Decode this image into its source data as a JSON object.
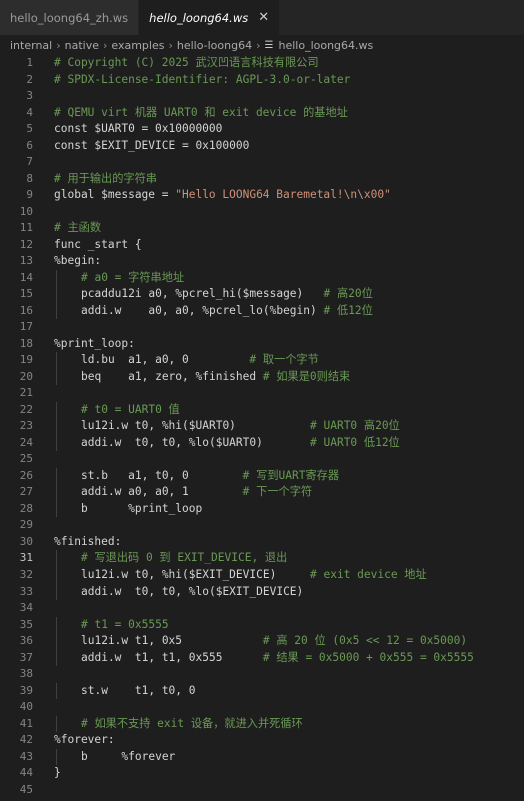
{
  "tabs": [
    {
      "label": "hello_loong64_zh.ws",
      "active": false
    },
    {
      "label": "hello_loong64.ws",
      "active": true
    }
  ],
  "close_glyph": "✕",
  "breadcrumb": [
    "internal",
    "native",
    "examples",
    "hello-loong64",
    "hello_loong64.ws"
  ],
  "breadcrumb_sep": "›",
  "current_line": 31,
  "colors": {
    "background": "#1e1e1e",
    "comment": "#6a9955",
    "string": "#ce9178",
    "text": "#d4d4d4",
    "line_number": "#858585"
  },
  "code_lines": [
    {
      "n": "1",
      "indent": 0,
      "text": "# Copyright (C) 2025 武汉凹语言科技有限公司",
      "kind": "comment"
    },
    {
      "n": "2",
      "indent": 0,
      "text": "# SPDX-License-Identifier: AGPL-3.0-or-later",
      "kind": "comment"
    },
    {
      "n": "3",
      "indent": 0,
      "text": "",
      "kind": "plain"
    },
    {
      "n": "4",
      "indent": 0,
      "text": "# QEMU virt 机器 UART0 和 exit device 的基地址",
      "kind": "comment"
    },
    {
      "n": "5",
      "indent": 0,
      "text": "const $UART0 = 0x10000000",
      "kind": "plain"
    },
    {
      "n": "6",
      "indent": 0,
      "text": "const $EXIT_DEVICE = 0x100000",
      "kind": "plain"
    },
    {
      "n": "7",
      "indent": 0,
      "text": "",
      "kind": "plain"
    },
    {
      "n": "8",
      "indent": 0,
      "text": "# 用于输出的字符串",
      "kind": "comment"
    },
    {
      "n": "9",
      "indent": 0,
      "text": "global $message = \"Hello LOONG64 Baremetal!\\n\\x00\"",
      "kind": "plain"
    },
    {
      "n": "10",
      "indent": 0,
      "text": "",
      "kind": "plain"
    },
    {
      "n": "11",
      "indent": 0,
      "text": "# 主函数",
      "kind": "comment"
    },
    {
      "n": "12",
      "indent": 0,
      "text": "func _start {",
      "kind": "plain"
    },
    {
      "n": "13",
      "indent": 0,
      "text": "%begin:",
      "kind": "plain"
    },
    {
      "n": "14",
      "indent": 1,
      "text": "# a0 = 字符串地址",
      "kind": "comment"
    },
    {
      "n": "15",
      "indent": 1,
      "text": "pcaddu12i a0, %pcrel_hi($message)   # 高20位",
      "kind": "plain"
    },
    {
      "n": "16",
      "indent": 1,
      "text": "addi.w    a0, a0, %pcrel_lo(%begin) # 低12位",
      "kind": "plain"
    },
    {
      "n": "17",
      "indent": 0,
      "text": "",
      "kind": "plain"
    },
    {
      "n": "18",
      "indent": 0,
      "text": "%print_loop:",
      "kind": "plain"
    },
    {
      "n": "19",
      "indent": 1,
      "text": "ld.bu  a1, a0, 0         # 取一个字节",
      "kind": "plain"
    },
    {
      "n": "20",
      "indent": 1,
      "text": "beq    a1, zero, %finished # 如果是0则结束",
      "kind": "plain"
    },
    {
      "n": "21",
      "indent": 0,
      "text": "",
      "kind": "plain"
    },
    {
      "n": "22",
      "indent": 1,
      "text": "# t0 = UART0 值",
      "kind": "comment"
    },
    {
      "n": "23",
      "indent": 1,
      "text": "lu12i.w t0, %hi($UART0)           # UART0 高20位",
      "kind": "plain"
    },
    {
      "n": "24",
      "indent": 1,
      "text": "addi.w  t0, t0, %lo($UART0)       # UART0 低12位",
      "kind": "plain"
    },
    {
      "n": "25",
      "indent": 0,
      "text": "",
      "kind": "plain"
    },
    {
      "n": "26",
      "indent": 1,
      "text": "st.b   a1, t0, 0        # 写到UART寄存器",
      "kind": "plain"
    },
    {
      "n": "27",
      "indent": 1,
      "text": "addi.w a0, a0, 1        # 下一个字符",
      "kind": "plain"
    },
    {
      "n": "28",
      "indent": 1,
      "text": "b      %print_loop",
      "kind": "plain"
    },
    {
      "n": "29",
      "indent": 0,
      "text": "",
      "kind": "plain"
    },
    {
      "n": "30",
      "indent": 0,
      "text": "%finished:",
      "kind": "plain"
    },
    {
      "n": "31",
      "indent": 1,
      "text": "# 写退出码 0 到 EXIT_DEVICE, 退出",
      "kind": "comment"
    },
    {
      "n": "32",
      "indent": 1,
      "text": "lu12i.w t0, %hi($EXIT_DEVICE)     # exit device 地址",
      "kind": "plain"
    },
    {
      "n": "33",
      "indent": 1,
      "text": "addi.w  t0, t0, %lo($EXIT_DEVICE)",
      "kind": "plain"
    },
    {
      "n": "34",
      "indent": 0,
      "text": "",
      "kind": "plain"
    },
    {
      "n": "35",
      "indent": 1,
      "text": "# t1 = 0x5555",
      "kind": "comment"
    },
    {
      "n": "36",
      "indent": 1,
      "text": "lu12i.w t1, 0x5            # 高 20 位 (0x5 << 12 = 0x5000)",
      "kind": "plain"
    },
    {
      "n": "37",
      "indent": 1,
      "text": "addi.w  t1, t1, 0x555      # 结果 = 0x5000 + 0x555 = 0x5555",
      "kind": "plain"
    },
    {
      "n": "38",
      "indent": 0,
      "text": "",
      "kind": "plain"
    },
    {
      "n": "39",
      "indent": 1,
      "text": "st.w    t1, t0, 0",
      "kind": "plain"
    },
    {
      "n": "40",
      "indent": 0,
      "text": "",
      "kind": "plain"
    },
    {
      "n": "41",
      "indent": 1,
      "text": "# 如果不支持 exit 设备，就进入并死循环",
      "kind": "comment"
    },
    {
      "n": "42",
      "indent": 0,
      "text": "%forever:",
      "kind": "plain"
    },
    {
      "n": "43",
      "indent": 1,
      "text": "b     %forever",
      "kind": "plain"
    },
    {
      "n": "44",
      "indent": 0,
      "text": "}",
      "kind": "plain"
    },
    {
      "n": "45",
      "indent": 0,
      "text": "",
      "kind": "plain"
    }
  ]
}
